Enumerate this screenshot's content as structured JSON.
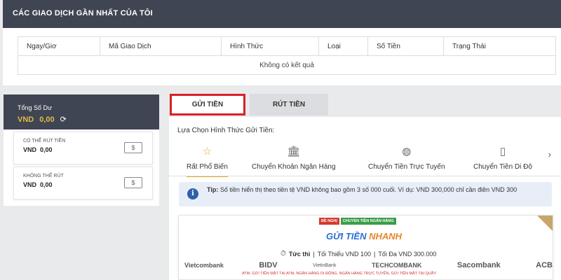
{
  "recent": {
    "title": "CÁC GIAO DỊCH GẦN NHẤT CỦA TÔI",
    "columns": [
      "Ngay/Giơ",
      "Mã Giao Dịch",
      "Hình Thức",
      "Loại",
      "Số Tiền",
      "Trạng Thái"
    ],
    "empty_text": "Không có kết quả"
  },
  "balance": {
    "title": "Tổng Số Dư",
    "currency": "VND",
    "amount": "0,00",
    "withdrawable": {
      "label": "CÓ THỂ RÚT TIỀN",
      "currency": "VND",
      "value": "0,00"
    },
    "non_withdrawable": {
      "label": "KHÔNG THỂ RÚT",
      "currency": "VND",
      "value": "0,00"
    }
  },
  "tabs": {
    "deposit": "GỬI TIỀN",
    "withdraw": "RÚT TIỀN"
  },
  "deposit": {
    "choose_label": "Lựa Chọn Hình Thức Gửi Tiền:",
    "methods": [
      {
        "label": "Rất Phổ Biến",
        "icon": "star-icon"
      },
      {
        "label": "Chuyển Khoản Ngân Hàng",
        "icon": "bank-icon"
      },
      {
        "label": "Chuyển Tiền Trực Tuyến",
        "icon": "globe-icon"
      },
      {
        "label": "Chuyển Tiền Di Độ",
        "icon": "mobile-icon"
      }
    ],
    "tip_prefix": "Tip:",
    "tip_text": "Số tiền hiển thị theo tiền tệ VND không bao gồm 3 số 000 cuối. Ví dụ: VND 300,000 chỉ cần điền VND 300"
  },
  "fast_card": {
    "badge_recommend": "ĐỀ NGHỊ",
    "badge_bank": "CHUYỂN TIỀN NGÂN HÀNG",
    "title_main": "GỬI TIỀN",
    "title_accent": "NHANH",
    "speed": "Tức thì",
    "min_label": "Tối Thiểu VND 100",
    "max_label": "Tối Đa VND 300.000",
    "banks": [
      "Vietcombank",
      "BIDV",
      "VietinBank",
      "TECHCOMBANK",
      "Sacombank",
      "ACB"
    ],
    "note": "ATM, GỬI TIỀN MẶT TẠI ATM, NGÂN HÀNG DI ĐỘNG, NGÂN HÀNG TRỰC TUYẾN, GỬI TIỀN MẶT TẠI QUẦY"
  },
  "colors": {
    "header_dark": "#3f4552",
    "accent_gold": "#e0b84a",
    "active_tab_border": "#d92027",
    "link_blue": "#2a6fd6"
  }
}
